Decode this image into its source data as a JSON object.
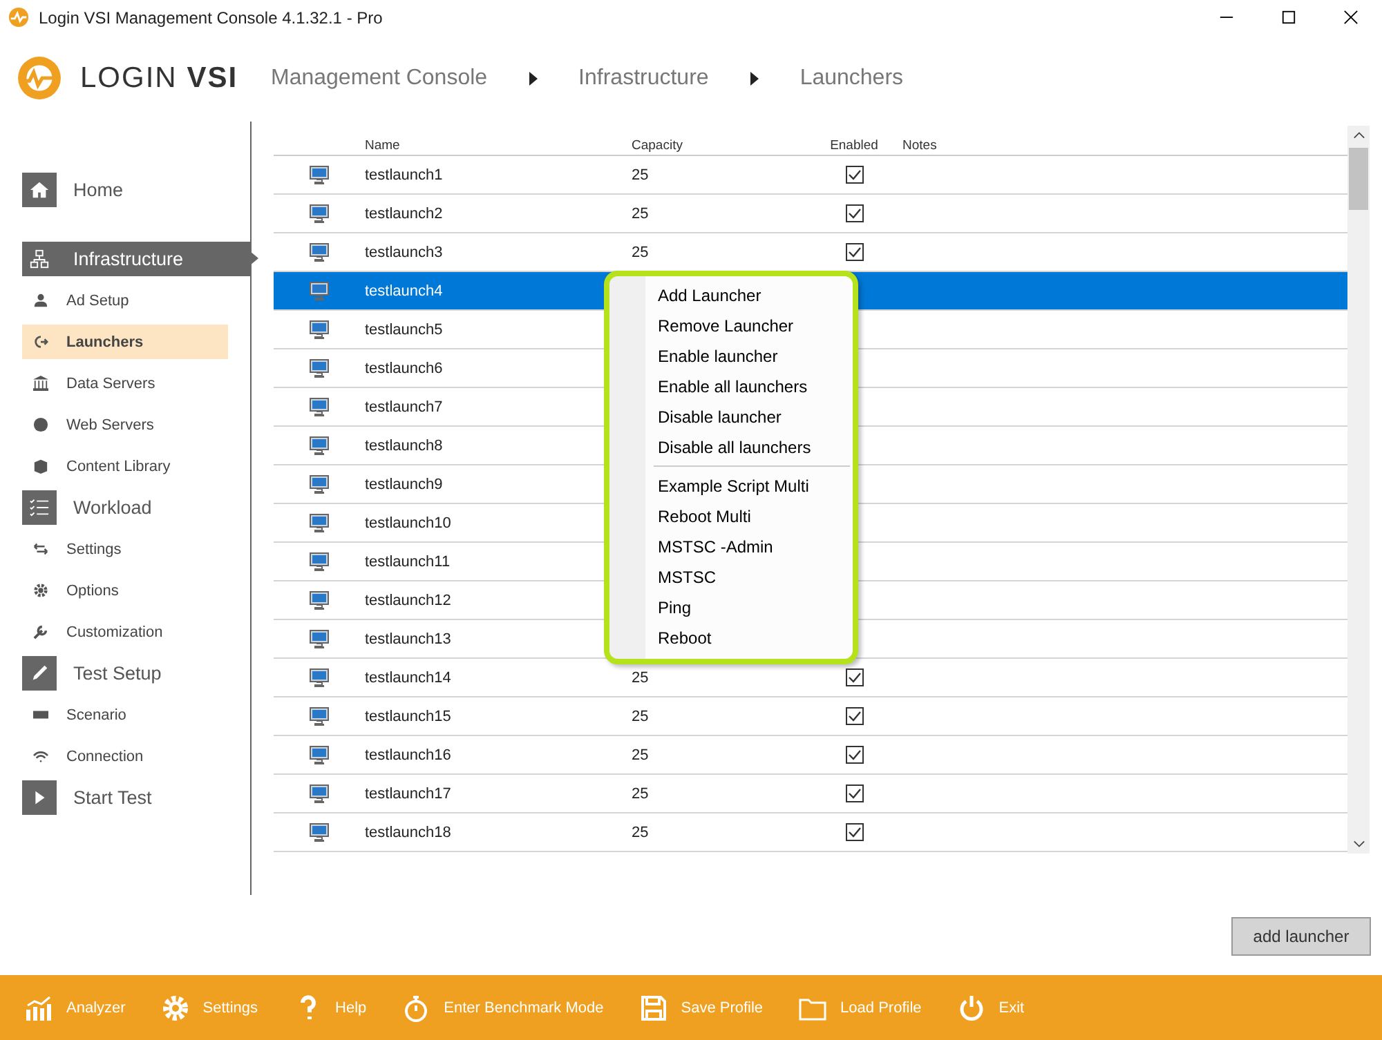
{
  "window": {
    "title": "Login VSI Management Console 4.1.32.1 - Pro"
  },
  "header": {
    "logo_text_light": "LOGIN",
    "logo_text_bold": "VSI",
    "breadcrumbs": [
      "Management Console",
      "Infrastructure",
      "Launchers"
    ]
  },
  "sidebar": [
    {
      "kind": "section",
      "label": "Home",
      "selected": false
    },
    {
      "kind": "section",
      "label": "Infrastructure",
      "selected": true
    },
    {
      "kind": "item",
      "label": "Ad Setup",
      "selected": false
    },
    {
      "kind": "item",
      "label": "Launchers",
      "selected": true
    },
    {
      "kind": "item",
      "label": "Data Servers",
      "selected": false
    },
    {
      "kind": "item",
      "label": "Web Servers",
      "selected": false
    },
    {
      "kind": "item",
      "label": "Content Library",
      "selected": false
    },
    {
      "kind": "section",
      "label": "Workload",
      "selected": false
    },
    {
      "kind": "item",
      "label": "Settings",
      "selected": false
    },
    {
      "kind": "item",
      "label": "Options",
      "selected": false
    },
    {
      "kind": "item",
      "label": "Customization",
      "selected": false
    },
    {
      "kind": "section",
      "label": "Test Setup",
      "selected": false
    },
    {
      "kind": "item",
      "label": "Scenario",
      "selected": false
    },
    {
      "kind": "item",
      "label": "Connection",
      "selected": false
    },
    {
      "kind": "section",
      "label": "Start Test",
      "selected": false
    }
  ],
  "table": {
    "columns": [
      "Name",
      "Capacity",
      "Enabled",
      "Notes"
    ],
    "rows": [
      {
        "name": "testlaunch1",
        "capacity": "25",
        "enabled": true,
        "selected": false
      },
      {
        "name": "testlaunch2",
        "capacity": "25",
        "enabled": true,
        "selected": false
      },
      {
        "name": "testlaunch3",
        "capacity": "25",
        "enabled": true,
        "selected": false
      },
      {
        "name": "testlaunch4",
        "selected": true
      },
      {
        "name": "testlaunch5",
        "selected": false
      },
      {
        "name": "testlaunch6",
        "selected": false
      },
      {
        "name": "testlaunch7",
        "selected": false
      },
      {
        "name": "testlaunch8",
        "selected": false
      },
      {
        "name": "testlaunch9",
        "selected": false
      },
      {
        "name": "testlaunch10",
        "selected": false
      },
      {
        "name": "testlaunch11",
        "selected": false
      },
      {
        "name": "testlaunch12",
        "selected": false
      },
      {
        "name": "testlaunch13",
        "selected": false
      },
      {
        "name": "testlaunch14",
        "capacity": "25",
        "enabled": true,
        "selected": false
      },
      {
        "name": "testlaunch15",
        "capacity": "25",
        "enabled": true,
        "selected": false
      },
      {
        "name": "testlaunch16",
        "capacity": "25",
        "enabled": true,
        "selected": false
      },
      {
        "name": "testlaunch17",
        "capacity": "25",
        "enabled": true,
        "selected": false
      },
      {
        "name": "testlaunch18",
        "capacity": "25",
        "enabled": true,
        "selected": false
      }
    ]
  },
  "context_menu": [
    {
      "kind": "item",
      "label": "Add Launcher"
    },
    {
      "kind": "item",
      "label": "Remove Launcher"
    },
    {
      "kind": "item",
      "label": "Enable launcher"
    },
    {
      "kind": "item",
      "label": "Enable all launchers"
    },
    {
      "kind": "item",
      "label": "Disable launcher"
    },
    {
      "kind": "item",
      "label": "Disable all launchers"
    },
    {
      "kind": "separator"
    },
    {
      "kind": "item",
      "label": "Example Script Multi"
    },
    {
      "kind": "item",
      "label": "Reboot Multi"
    },
    {
      "kind": "item",
      "label": "MSTSC -Admin"
    },
    {
      "kind": "item",
      "label": "MSTSC"
    },
    {
      "kind": "item",
      "label": "Ping"
    },
    {
      "kind": "item",
      "label": "Reboot"
    }
  ],
  "add_button": "add launcher",
  "footer": [
    {
      "label": "Analyzer"
    },
    {
      "label": "Settings"
    },
    {
      "label": "Help"
    },
    {
      "label": "Enter Benchmark Mode"
    },
    {
      "label": "Save Profile"
    },
    {
      "label": "Load Profile"
    },
    {
      "label": "Exit"
    }
  ]
}
